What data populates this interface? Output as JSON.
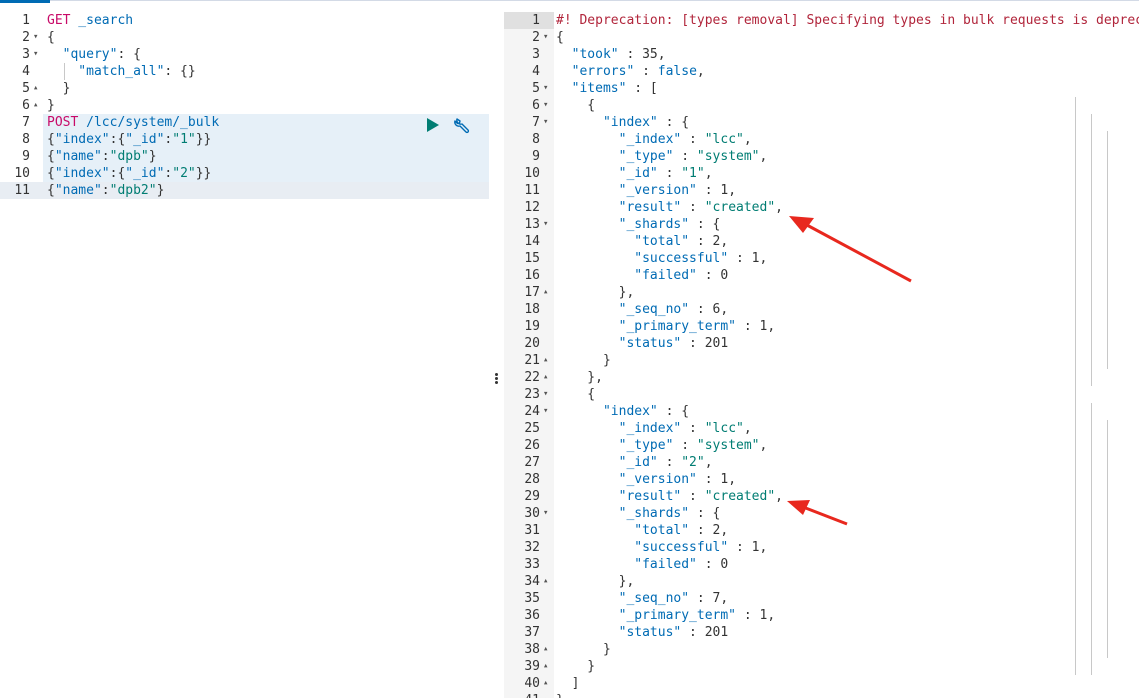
{
  "request_editor": {
    "lines": [
      {
        "n": "1",
        "fold": "",
        "tokens": [
          {
            "c": "t-method",
            "t": "GET"
          },
          {
            "c": "t-url",
            "t": " _search"
          }
        ]
      },
      {
        "n": "2",
        "fold": "▾",
        "tokens": [
          {
            "c": "t-punc",
            "t": "{"
          }
        ]
      },
      {
        "n": "3",
        "fold": "▾",
        "tokens": [
          {
            "c": "t-key",
            "t": "  \"query\""
          },
          {
            "c": "t-punc",
            "t": ": {"
          }
        ]
      },
      {
        "n": "4",
        "fold": "",
        "tokens": [
          {
            "c": "t-key",
            "t": "    \"match_all\""
          },
          {
            "c": "t-punc",
            "t": ": {}"
          }
        ]
      },
      {
        "n": "5",
        "fold": "▴",
        "tokens": [
          {
            "c": "t-punc",
            "t": "  }"
          }
        ]
      },
      {
        "n": "6",
        "fold": "▴",
        "tokens": [
          {
            "c": "t-punc",
            "t": "}"
          }
        ]
      },
      {
        "n": "7",
        "fold": "",
        "tokens": [
          {
            "c": "t-method",
            "t": "POST"
          },
          {
            "c": "t-url",
            "t": " /lcc/system/_bulk"
          }
        ]
      },
      {
        "n": "8",
        "fold": "",
        "tokens": [
          {
            "c": "t-punc",
            "t": "{"
          },
          {
            "c": "t-key",
            "t": "\"index\""
          },
          {
            "c": "t-punc",
            "t": ":{"
          },
          {
            "c": "t-key",
            "t": "\"_id\""
          },
          {
            "c": "t-punc",
            "t": ":"
          },
          {
            "c": "t-str",
            "t": "\"1\""
          },
          {
            "c": "t-punc",
            "t": "}}"
          }
        ]
      },
      {
        "n": "9",
        "fold": "",
        "tokens": [
          {
            "c": "t-punc",
            "t": "{"
          },
          {
            "c": "t-key",
            "t": "\"name\""
          },
          {
            "c": "t-punc",
            "t": ":"
          },
          {
            "c": "t-str",
            "t": "\"dpb\""
          },
          {
            "c": "t-punc",
            "t": "}"
          }
        ]
      },
      {
        "n": "10",
        "fold": "",
        "tokens": [
          {
            "c": "t-punc",
            "t": "{"
          },
          {
            "c": "t-key",
            "t": "\"index\""
          },
          {
            "c": "t-punc",
            "t": ":{"
          },
          {
            "c": "t-key",
            "t": "\"_id\""
          },
          {
            "c": "t-punc",
            "t": ":"
          },
          {
            "c": "t-str",
            "t": "\"2\""
          },
          {
            "c": "t-punc",
            "t": "}}"
          }
        ]
      },
      {
        "n": "11",
        "fold": "",
        "tokens": [
          {
            "c": "t-punc",
            "t": "{"
          },
          {
            "c": "t-key",
            "t": "\"name\""
          },
          {
            "c": "t-punc",
            "t": ":"
          },
          {
            "c": "t-str",
            "t": "\"dpb2\""
          },
          {
            "c": "t-punc",
            "t": "}"
          }
        ]
      }
    ],
    "actions": {
      "run_icon": "play-icon",
      "settings_icon": "wrench-icon"
    }
  },
  "response_editor": {
    "lines": [
      {
        "n": "1",
        "fold": "",
        "tokens": [
          {
            "c": "t-comment",
            "t": "#! Deprecation: [types removal] Specifying types in bulk requests is deprecated."
          }
        ]
      },
      {
        "n": "2",
        "fold": "▾",
        "tokens": [
          {
            "c": "t-punc",
            "t": "{"
          }
        ]
      },
      {
        "n": "3",
        "fold": "",
        "tokens": [
          {
            "c": "t-key",
            "t": "  \"took\""
          },
          {
            "c": "t-punc",
            "t": " : "
          },
          {
            "c": "t-num",
            "t": "35"
          },
          {
            "c": "t-punc",
            "t": ","
          }
        ]
      },
      {
        "n": "4",
        "fold": "",
        "tokens": [
          {
            "c": "t-key",
            "t": "  \"errors\""
          },
          {
            "c": "t-punc",
            "t": " : "
          },
          {
            "c": "t-bool",
            "t": "false"
          },
          {
            "c": "t-punc",
            "t": ","
          }
        ]
      },
      {
        "n": "5",
        "fold": "▾",
        "tokens": [
          {
            "c": "t-key",
            "t": "  \"items\""
          },
          {
            "c": "t-punc",
            "t": " : ["
          }
        ]
      },
      {
        "n": "6",
        "fold": "▾",
        "tokens": [
          {
            "c": "t-punc",
            "t": "    {"
          }
        ]
      },
      {
        "n": "7",
        "fold": "▾",
        "tokens": [
          {
            "c": "t-key",
            "t": "      \"index\""
          },
          {
            "c": "t-punc",
            "t": " : {"
          }
        ]
      },
      {
        "n": "8",
        "fold": "",
        "tokens": [
          {
            "c": "t-key",
            "t": "        \"_index\""
          },
          {
            "c": "t-punc",
            "t": " : "
          },
          {
            "c": "t-str",
            "t": "\"lcc\""
          },
          {
            "c": "t-punc",
            "t": ","
          }
        ]
      },
      {
        "n": "9",
        "fold": "",
        "tokens": [
          {
            "c": "t-key",
            "t": "        \"_type\""
          },
          {
            "c": "t-punc",
            "t": " : "
          },
          {
            "c": "t-str",
            "t": "\"system\""
          },
          {
            "c": "t-punc",
            "t": ","
          }
        ]
      },
      {
        "n": "10",
        "fold": "",
        "tokens": [
          {
            "c": "t-key",
            "t": "        \"_id\""
          },
          {
            "c": "t-punc",
            "t": " : "
          },
          {
            "c": "t-str",
            "t": "\"1\""
          },
          {
            "c": "t-punc",
            "t": ","
          }
        ]
      },
      {
        "n": "11",
        "fold": "",
        "tokens": [
          {
            "c": "t-key",
            "t": "        \"_version\""
          },
          {
            "c": "t-punc",
            "t": " : "
          },
          {
            "c": "t-num",
            "t": "1"
          },
          {
            "c": "t-punc",
            "t": ","
          }
        ]
      },
      {
        "n": "12",
        "fold": "",
        "tokens": [
          {
            "c": "t-key",
            "t": "        \"result\""
          },
          {
            "c": "t-punc",
            "t": " : "
          },
          {
            "c": "t-str",
            "t": "\"created\""
          },
          {
            "c": "t-punc",
            "t": ","
          }
        ]
      },
      {
        "n": "13",
        "fold": "▾",
        "tokens": [
          {
            "c": "t-key",
            "t": "        \"_shards\""
          },
          {
            "c": "t-punc",
            "t": " : {"
          }
        ]
      },
      {
        "n": "14",
        "fold": "",
        "tokens": [
          {
            "c": "t-key",
            "t": "          \"total\""
          },
          {
            "c": "t-punc",
            "t": " : "
          },
          {
            "c": "t-num",
            "t": "2"
          },
          {
            "c": "t-punc",
            "t": ","
          }
        ]
      },
      {
        "n": "15",
        "fold": "",
        "tokens": [
          {
            "c": "t-key",
            "t": "          \"successful\""
          },
          {
            "c": "t-punc",
            "t": " : "
          },
          {
            "c": "t-num",
            "t": "1"
          },
          {
            "c": "t-punc",
            "t": ","
          }
        ]
      },
      {
        "n": "16",
        "fold": "",
        "tokens": [
          {
            "c": "t-key",
            "t": "          \"failed\""
          },
          {
            "c": "t-punc",
            "t": " : "
          },
          {
            "c": "t-num",
            "t": "0"
          }
        ]
      },
      {
        "n": "17",
        "fold": "▴",
        "tokens": [
          {
            "c": "t-punc",
            "t": "        },"
          }
        ]
      },
      {
        "n": "18",
        "fold": "",
        "tokens": [
          {
            "c": "t-key",
            "t": "        \"_seq_no\""
          },
          {
            "c": "t-punc",
            "t": " : "
          },
          {
            "c": "t-num",
            "t": "6"
          },
          {
            "c": "t-punc",
            "t": ","
          }
        ]
      },
      {
        "n": "19",
        "fold": "",
        "tokens": [
          {
            "c": "t-key",
            "t": "        \"_primary_term\""
          },
          {
            "c": "t-punc",
            "t": " : "
          },
          {
            "c": "t-num",
            "t": "1"
          },
          {
            "c": "t-punc",
            "t": ","
          }
        ]
      },
      {
        "n": "20",
        "fold": "",
        "tokens": [
          {
            "c": "t-key",
            "t": "        \"status\""
          },
          {
            "c": "t-punc",
            "t": " : "
          },
          {
            "c": "t-num",
            "t": "201"
          }
        ]
      },
      {
        "n": "21",
        "fold": "▴",
        "tokens": [
          {
            "c": "t-punc",
            "t": "      }"
          }
        ]
      },
      {
        "n": "22",
        "fold": "▴",
        "tokens": [
          {
            "c": "t-punc",
            "t": "    },"
          }
        ]
      },
      {
        "n": "23",
        "fold": "▾",
        "tokens": [
          {
            "c": "t-punc",
            "t": "    {"
          }
        ]
      },
      {
        "n": "24",
        "fold": "▾",
        "tokens": [
          {
            "c": "t-key",
            "t": "      \"index\""
          },
          {
            "c": "t-punc",
            "t": " : {"
          }
        ]
      },
      {
        "n": "25",
        "fold": "",
        "tokens": [
          {
            "c": "t-key",
            "t": "        \"_index\""
          },
          {
            "c": "t-punc",
            "t": " : "
          },
          {
            "c": "t-str",
            "t": "\"lcc\""
          },
          {
            "c": "t-punc",
            "t": ","
          }
        ]
      },
      {
        "n": "26",
        "fold": "",
        "tokens": [
          {
            "c": "t-key",
            "t": "        \"_type\""
          },
          {
            "c": "t-punc",
            "t": " : "
          },
          {
            "c": "t-str",
            "t": "\"system\""
          },
          {
            "c": "t-punc",
            "t": ","
          }
        ]
      },
      {
        "n": "27",
        "fold": "",
        "tokens": [
          {
            "c": "t-key",
            "t": "        \"_id\""
          },
          {
            "c": "t-punc",
            "t": " : "
          },
          {
            "c": "t-str",
            "t": "\"2\""
          },
          {
            "c": "t-punc",
            "t": ","
          }
        ]
      },
      {
        "n": "28",
        "fold": "",
        "tokens": [
          {
            "c": "t-key",
            "t": "        \"_version\""
          },
          {
            "c": "t-punc",
            "t": " : "
          },
          {
            "c": "t-num",
            "t": "1"
          },
          {
            "c": "t-punc",
            "t": ","
          }
        ]
      },
      {
        "n": "29",
        "fold": "",
        "tokens": [
          {
            "c": "t-key",
            "t": "        \"result\""
          },
          {
            "c": "t-punc",
            "t": " : "
          },
          {
            "c": "t-str",
            "t": "\"created\""
          },
          {
            "c": "t-punc",
            "t": ","
          }
        ]
      },
      {
        "n": "30",
        "fold": "▾",
        "tokens": [
          {
            "c": "t-key",
            "t": "        \"_shards\""
          },
          {
            "c": "t-punc",
            "t": " : {"
          }
        ]
      },
      {
        "n": "31",
        "fold": "",
        "tokens": [
          {
            "c": "t-key",
            "t": "          \"total\""
          },
          {
            "c": "t-punc",
            "t": " : "
          },
          {
            "c": "t-num",
            "t": "2"
          },
          {
            "c": "t-punc",
            "t": ","
          }
        ]
      },
      {
        "n": "32",
        "fold": "",
        "tokens": [
          {
            "c": "t-key",
            "t": "          \"successful\""
          },
          {
            "c": "t-punc",
            "t": " : "
          },
          {
            "c": "t-num",
            "t": "1"
          },
          {
            "c": "t-punc",
            "t": ","
          }
        ]
      },
      {
        "n": "33",
        "fold": "",
        "tokens": [
          {
            "c": "t-key",
            "t": "          \"failed\""
          },
          {
            "c": "t-punc",
            "t": " : "
          },
          {
            "c": "t-num",
            "t": "0"
          }
        ]
      },
      {
        "n": "34",
        "fold": "▴",
        "tokens": [
          {
            "c": "t-punc",
            "t": "        },"
          }
        ]
      },
      {
        "n": "35",
        "fold": "",
        "tokens": [
          {
            "c": "t-key",
            "t": "        \"_seq_no\""
          },
          {
            "c": "t-punc",
            "t": " : "
          },
          {
            "c": "t-num",
            "t": "7"
          },
          {
            "c": "t-punc",
            "t": ","
          }
        ]
      },
      {
        "n": "36",
        "fold": "",
        "tokens": [
          {
            "c": "t-key",
            "t": "        \"_primary_term\""
          },
          {
            "c": "t-punc",
            "t": " : "
          },
          {
            "c": "t-num",
            "t": "1"
          },
          {
            "c": "t-punc",
            "t": ","
          }
        ]
      },
      {
        "n": "37",
        "fold": "",
        "tokens": [
          {
            "c": "t-key",
            "t": "        \"status\""
          },
          {
            "c": "t-punc",
            "t": " : "
          },
          {
            "c": "t-num",
            "t": "201"
          }
        ]
      },
      {
        "n": "38",
        "fold": "▴",
        "tokens": [
          {
            "c": "t-punc",
            "t": "      }"
          }
        ]
      },
      {
        "n": "39",
        "fold": "▴",
        "tokens": [
          {
            "c": "t-punc",
            "t": "    }"
          }
        ]
      },
      {
        "n": "40",
        "fold": "▴",
        "tokens": [
          {
            "c": "t-punc",
            "t": "  ]"
          }
        ]
      },
      {
        "n": "41",
        "fold": "▴",
        "tokens": [
          {
            "c": "t-punc",
            "t": "}"
          }
        ]
      }
    ]
  },
  "annotations": {
    "arrow_color": "#e8281e"
  },
  "colors": {
    "method": "#c80a68",
    "key": "#006bb4",
    "string": "#017d73",
    "comment": "#b1253b"
  }
}
